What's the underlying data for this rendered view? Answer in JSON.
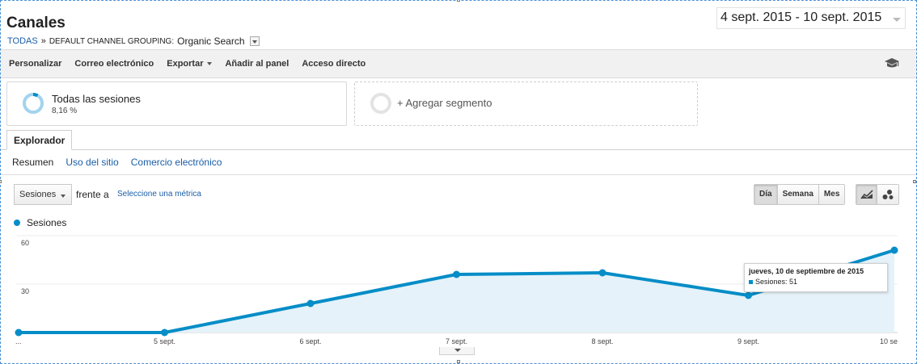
{
  "header": {
    "title": "Canales",
    "breadcrumb": {
      "all": "TODAS",
      "separator": "»",
      "dimension": "DEFAULT CHANNEL GROUPING:",
      "value": "Organic Search"
    },
    "date_range": "4 sept. 2015 - 10 sept. 2015"
  },
  "toolbar": {
    "items": [
      "Personalizar",
      "Correo electrónico",
      "Exportar",
      "Añadir al panel",
      "Acceso directo"
    ],
    "icons": [
      "graduation-cap-icon"
    ]
  },
  "segments": {
    "active": {
      "name": "Todas las sesiones",
      "percent": "8,16 %"
    },
    "add": "+ Agregar segmento"
  },
  "tabs": {
    "explorer": "Explorador"
  },
  "subtabs": [
    "Resumen",
    "Uso del sitio",
    "Comercio electrónico"
  ],
  "controls": {
    "metric": "Sesiones",
    "versus": "frente a",
    "select_metric": "Seleccione una métrica",
    "granularity": [
      "Día",
      "Semana",
      "Mes"
    ],
    "granularity_selected": "Día"
  },
  "legend": {
    "series": "Sesiones"
  },
  "tooltip": {
    "title": "jueves, 10 de septiembre de 2015",
    "label": "Sesiones: 51"
  },
  "colors": {
    "series": "#058dc7",
    "area": "#e5f2f9"
  },
  "chart_data": {
    "type": "area",
    "x": [
      "4 sept.",
      "5 sept.",
      "6 sept.",
      "7 sept.",
      "8 sept.",
      "9 sept.",
      "10 sept."
    ],
    "x_tick_labels": [
      "...",
      "5 sept.",
      "6 sept.",
      "7 sept.",
      "8 sept.",
      "9 sept.",
      "10 se"
    ],
    "series": [
      {
        "name": "Sesiones",
        "values": [
          0,
          0,
          18,
          36,
          37,
          23,
          51
        ]
      }
    ],
    "y_ticks": [
      "60",
      "30"
    ],
    "ylim": [
      0,
      60
    ],
    "grid": true
  }
}
